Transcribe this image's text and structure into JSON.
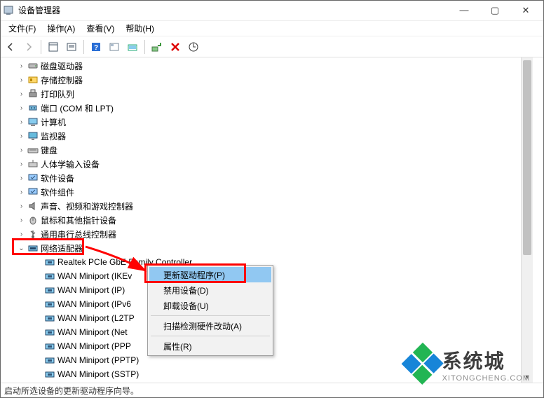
{
  "window": {
    "title": "设备管理器",
    "controls": {
      "min": "—",
      "max": "▢",
      "close": "✕"
    }
  },
  "menubar": {
    "file": "文件(F)",
    "action": "操作(A)",
    "view": "查看(V)",
    "help": "帮助(H)"
  },
  "tree": {
    "items": [
      {
        "label": "磁盘驱动器",
        "indent": "child",
        "expander": ">"
      },
      {
        "label": "存储控制器",
        "indent": "child",
        "expander": ">"
      },
      {
        "label": "打印队列",
        "indent": "child",
        "expander": ">"
      },
      {
        "label": "端口 (COM 和 LPT)",
        "indent": "child",
        "expander": ">"
      },
      {
        "label": "计算机",
        "indent": "child",
        "expander": ">"
      },
      {
        "label": "监视器",
        "indent": "child",
        "expander": ">"
      },
      {
        "label": "键盘",
        "indent": "child",
        "expander": ">"
      },
      {
        "label": "人体学输入设备",
        "indent": "child",
        "expander": ">"
      },
      {
        "label": "软件设备",
        "indent": "child",
        "expander": ">"
      },
      {
        "label": "软件组件",
        "indent": "child",
        "expander": ">"
      },
      {
        "label": "声音、视频和游戏控制器",
        "indent": "child",
        "expander": ">"
      },
      {
        "label": "鼠标和其他指针设备",
        "indent": "child",
        "expander": ">"
      },
      {
        "label": "通用串行总线控制器",
        "indent": "child",
        "expander": ">"
      },
      {
        "label": "网络适配器",
        "indent": "child",
        "expander": "v",
        "selected": true
      },
      {
        "label": "Realtek PCIe GbE Family Controller",
        "indent": "grandchild",
        "expander": ""
      },
      {
        "label": "WAN Miniport (IKEv",
        "indent": "grandchild",
        "expander": ""
      },
      {
        "label": "WAN Miniport (IP)",
        "indent": "grandchild",
        "expander": ""
      },
      {
        "label": "WAN Miniport (IPv6",
        "indent": "grandchild",
        "expander": ""
      },
      {
        "label": "WAN Miniport (L2TP",
        "indent": "grandchild",
        "expander": ""
      },
      {
        "label": "WAN Miniport (Net",
        "indent": "grandchild",
        "expander": ""
      },
      {
        "label": "WAN Miniport (PPP",
        "indent": "grandchild",
        "expander": ""
      },
      {
        "label": "WAN Miniport (PPTP)",
        "indent": "grandchild",
        "expander": ""
      },
      {
        "label": "WAN Miniport (SSTP)",
        "indent": "grandchild",
        "expander": ""
      }
    ]
  },
  "context_menu": {
    "update": "更新驱动程序(P)",
    "disable": "禁用设备(D)",
    "uninstall": "卸载设备(U)",
    "scan": "扫描检测硬件改动(A)",
    "properties": "属性(R)"
  },
  "statusbar": {
    "text": "启动所选设备的更新驱动程序向导。"
  },
  "watermark": {
    "main": "系统城",
    "sub": "XITONGCHENG.COM"
  },
  "colors": {
    "highlight_red": "#ff0000",
    "ctx_highlight": "#91c8f2"
  }
}
